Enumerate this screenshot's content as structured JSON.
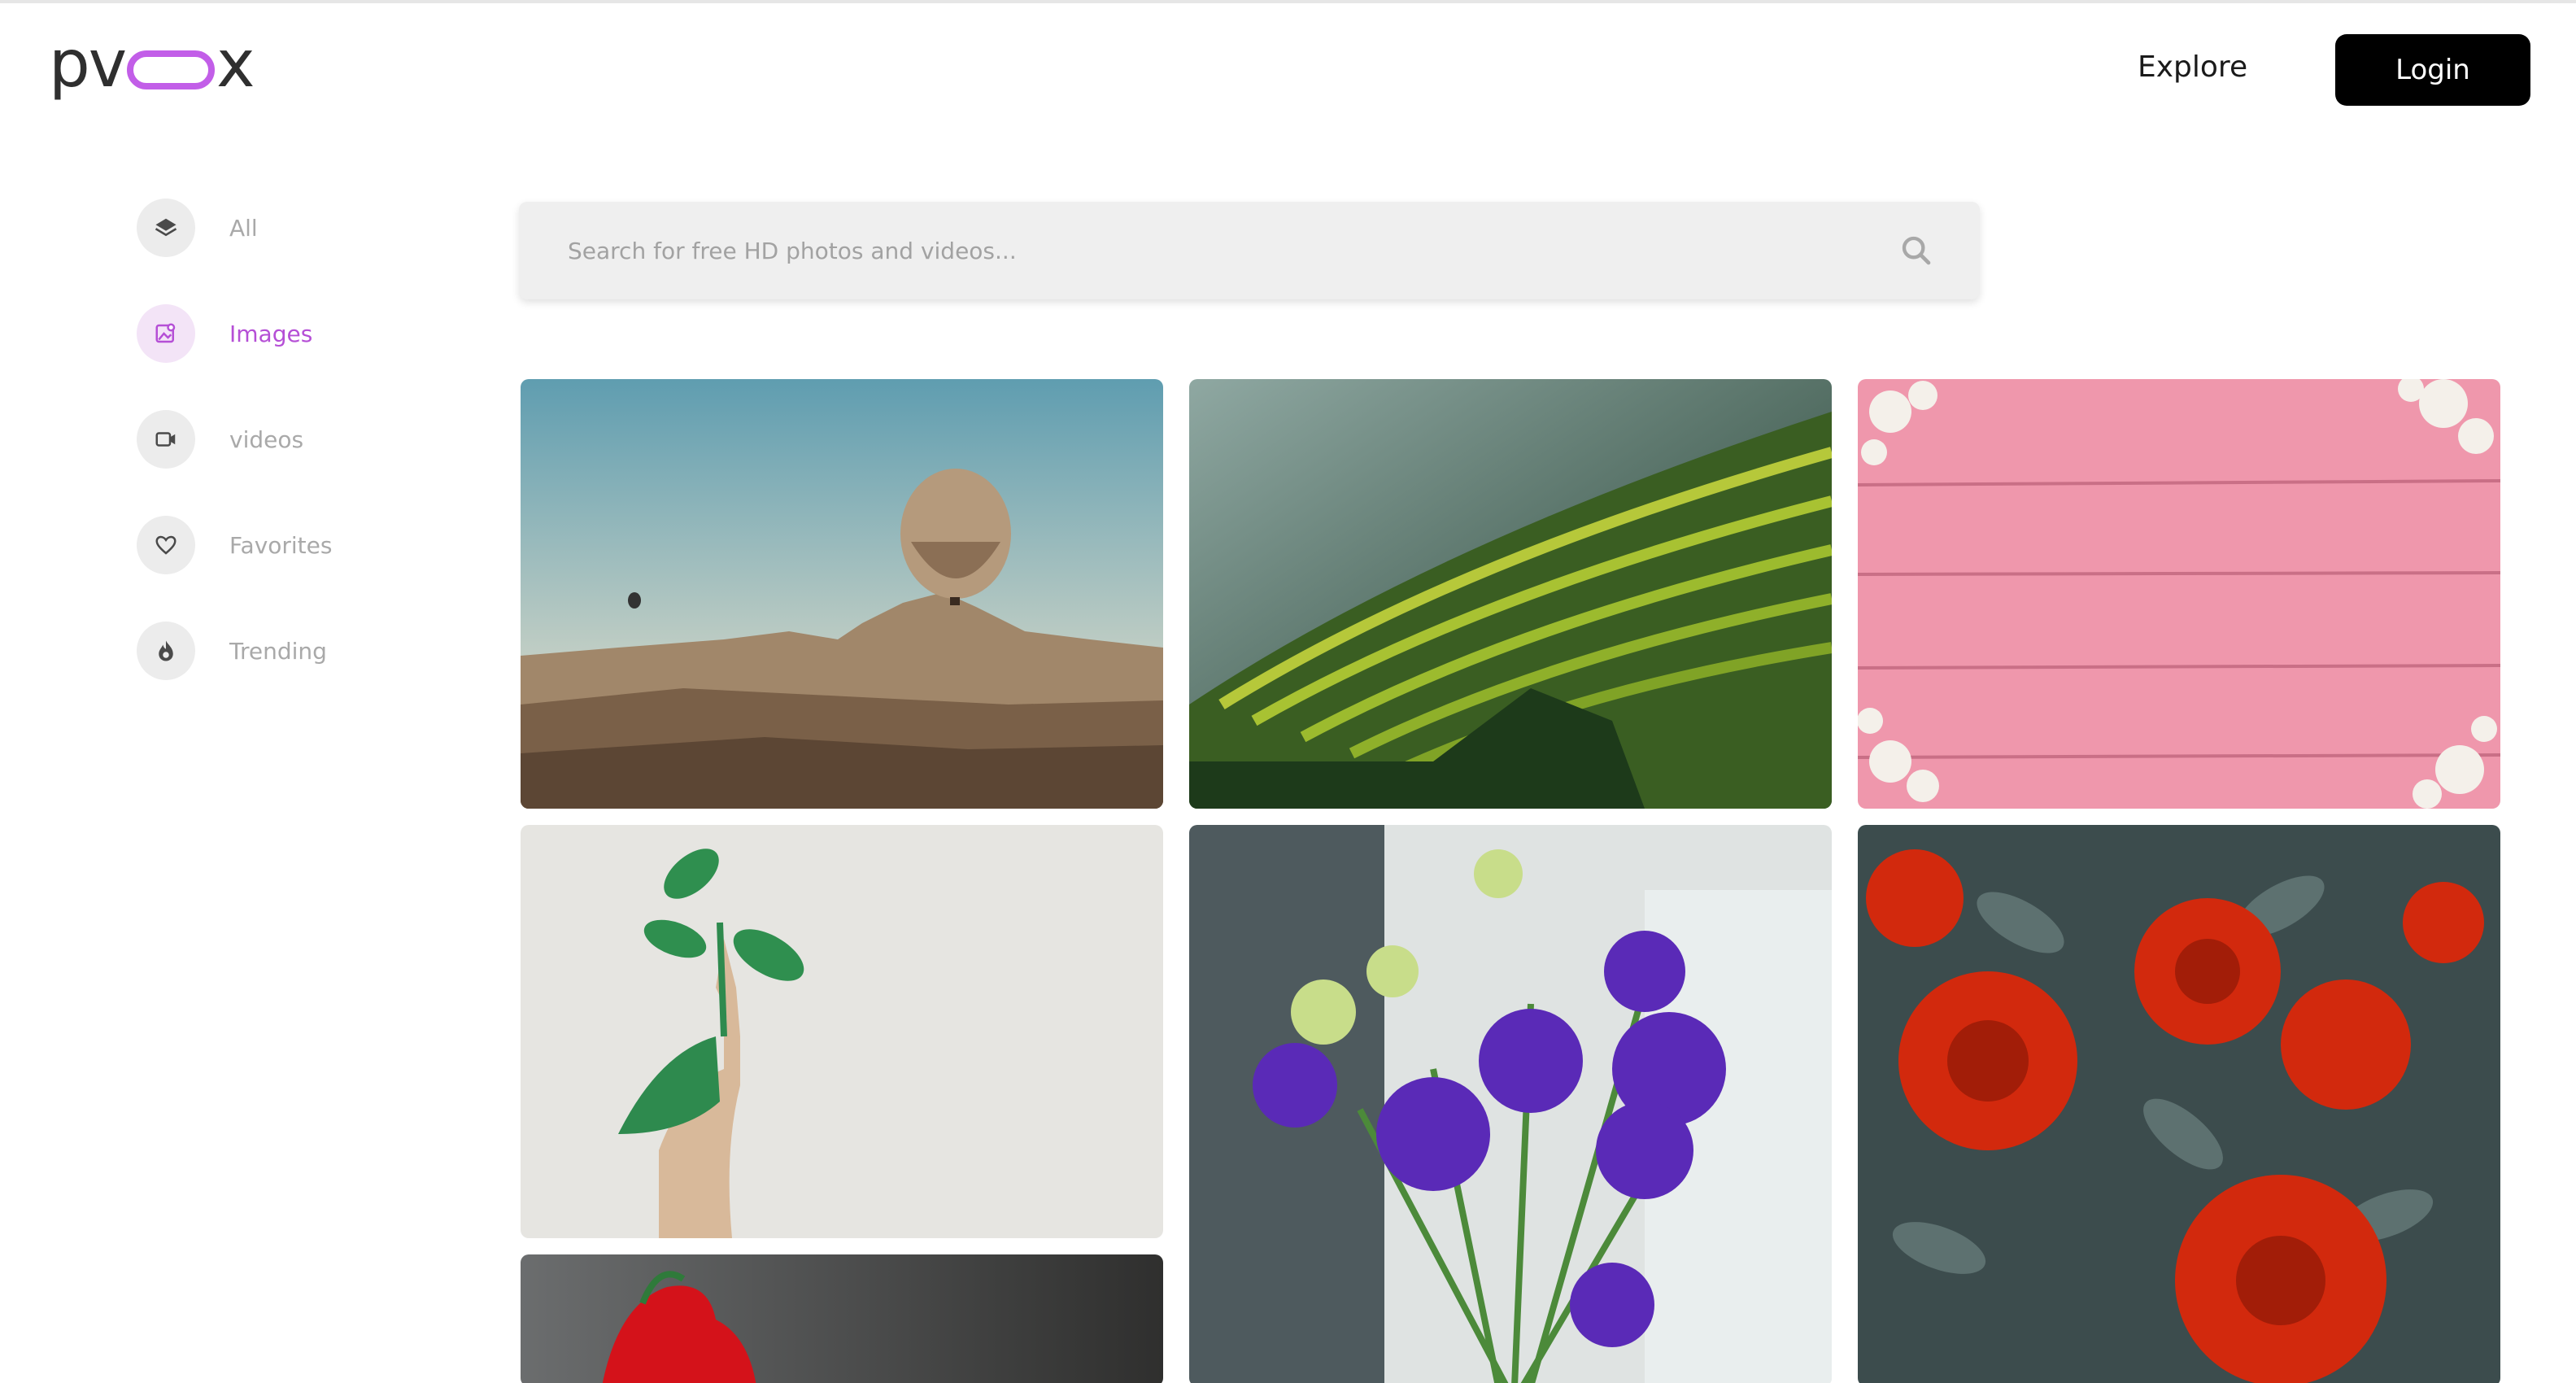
{
  "brand": {
    "logo_left": "pv",
    "logo_right": "x"
  },
  "nav": {
    "explore_label": "Explore",
    "login_label": "Login"
  },
  "sidebar": {
    "items": [
      {
        "label": "All",
        "icon": "layers-icon",
        "active": false
      },
      {
        "label": "Images",
        "icon": "image-icon",
        "active": true
      },
      {
        "label": "videos",
        "icon": "video-icon",
        "active": false
      },
      {
        "label": "Favorites",
        "icon": "heart-icon",
        "active": false
      },
      {
        "label": "Trending",
        "icon": "flame-icon",
        "active": false
      }
    ]
  },
  "search": {
    "placeholder": "Search for free HD photos and videos..."
  },
  "gallery": [
    {
      "subject": "hot air balloons over desert landscape"
    },
    {
      "subject": "green rice terraces"
    },
    {
      "subject": "pink wooden planks with white flowers"
    },
    {
      "subject": "green painted hand holding plant"
    },
    {
      "subject": "purple lisianthus flowers"
    },
    {
      "subject": "red roses with grey leaves"
    },
    {
      "subject": "red flower on dark background"
    }
  ],
  "colors": {
    "accent": "#b54fd6",
    "login_bg": "#000000",
    "search_bg": "#efefef"
  }
}
